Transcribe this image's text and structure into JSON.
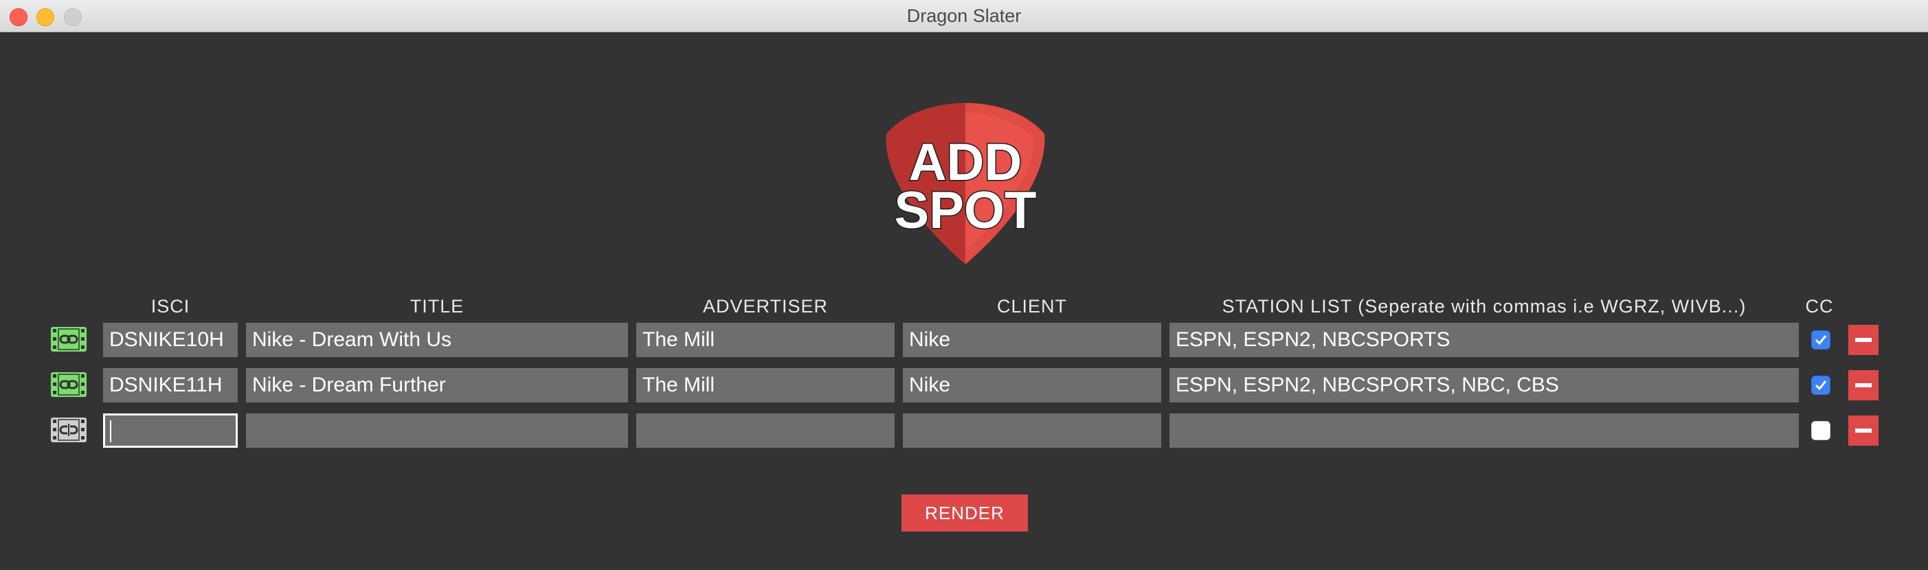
{
  "window": {
    "title": "Dragon Slater"
  },
  "logo": {
    "line1": "ADD",
    "line2": "SPOT"
  },
  "columns": {
    "isci": "ISCI",
    "title": "TITLE",
    "advertiser": "ADVERTISER",
    "client": "CLIENT",
    "station_list": "STATION LIST (Seperate with commas i.e WGRZ, WIVB...)",
    "cc": "CC"
  },
  "rows": [
    {
      "linked": true,
      "isci": "DSNIKE10H",
      "title": "Nike - Dream With Us",
      "advertiser": "The Mill",
      "client": "Nike",
      "station_list": "ESPN, ESPN2, NBCSPORTS",
      "cc": true
    },
    {
      "linked": true,
      "isci": "DSNIKE11H",
      "title": "Nike - Dream Further",
      "advertiser": "The Mill",
      "client": "Nike",
      "station_list": "ESPN, ESPN2, NBCSPORTS, NBC, CBS",
      "cc": true
    },
    {
      "linked": false,
      "isci": "",
      "title": "",
      "advertiser": "",
      "client": "",
      "station_list": "",
      "cc": false
    }
  ],
  "actions": {
    "render_label": "RENDER"
  },
  "colors": {
    "background": "#333333",
    "field": "#6e6e6e",
    "accent_red": "#de4848",
    "checkbox_blue": "#3b82f6",
    "linked_icon_green": "#7ddc6e",
    "unlinked_icon_gray": "#cfcfcf"
  },
  "icons": {
    "row_link": "film-link-icon",
    "remove": "minus-icon"
  }
}
